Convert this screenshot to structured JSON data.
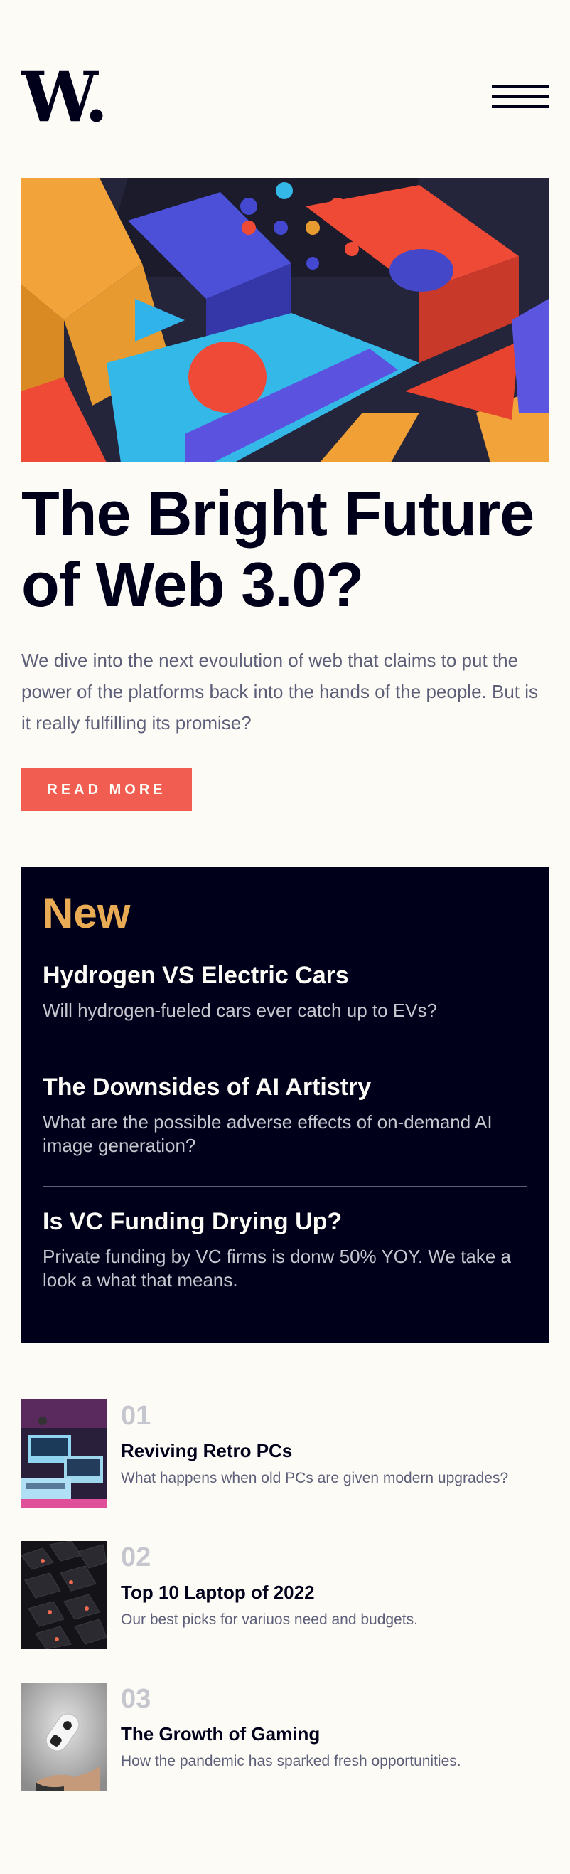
{
  "header": {
    "logo": "W.",
    "menu_icon": "hamburger-menu-icon"
  },
  "hero": {
    "image_alt": "Colorful abstract 3D geometric blocks",
    "title_line1": "The Bright Future",
    "title_line2": "of Web 3.0?",
    "description": "We dive into the next evoulution of web that claims to put the power of the platforms back into the hands of the people. But is it really fulfilling its promise?",
    "cta_label": "READ MORE"
  },
  "new_section": {
    "title": "New",
    "items": [
      {
        "title": "Hydrogen VS Electric Cars",
        "desc": "Will hydrogen-fueled cars ever catch up to EVs?"
      },
      {
        "title": "The Downsides of AI Artistry",
        "desc": "What are the possible adverse effects of on-demand AI image generation?"
      },
      {
        "title": "Is VC Funding Drying Up?",
        "desc": "Private funding by VC firms is donw 50% YOY. We take a look a what that means."
      }
    ]
  },
  "articles": [
    {
      "number": "01",
      "title": "Reviving Retro PCs",
      "desc": "What happens when old PCs are given modern upgrades?",
      "image": "retro-pcs-thumbnail"
    },
    {
      "number": "02",
      "title": "Top 10 Laptop of 2022",
      "desc": "Our best picks for variuos need and budgets.",
      "image": "laptop-keyboard-thumbnail"
    },
    {
      "number": "03",
      "title": "The Growth of Gaming",
      "desc": "How the pandemic has sparked fresh opportunities.",
      "image": "gaming-controller-thumbnail"
    }
  ],
  "colors": {
    "background": "#fdfbf6",
    "dark_navy": "#00001a",
    "accent_red": "#f15d51",
    "accent_orange": "#e9ab53",
    "grayish_blue": "#5d5f79",
    "light_gray": "#c5c6ce"
  }
}
